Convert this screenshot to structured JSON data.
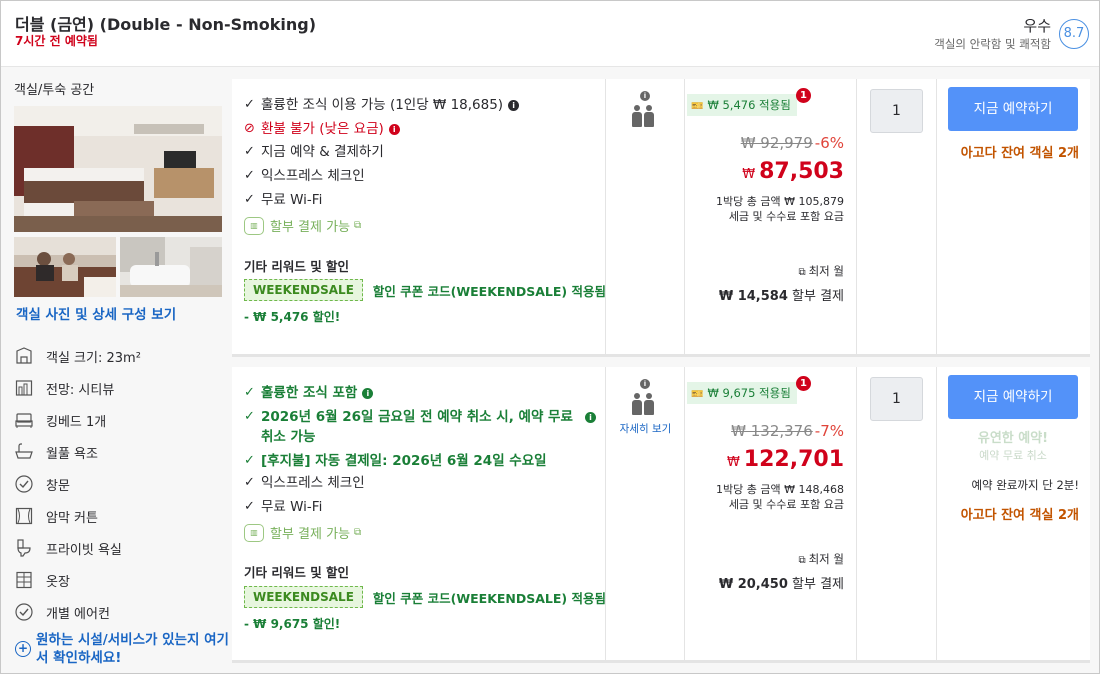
{
  "header": {
    "title": "더블 (금연) (Double - Non-Smoking)",
    "booked_ago": "7시간 전 예약됨",
    "rating_word": "우수",
    "rating_sub": "객실의 안락함 및 쾌적함",
    "score": "8.7"
  },
  "left": {
    "section_title": "객실/투숙 공간",
    "photos_link": "객실 사진 및 상세 구성 보기",
    "features": [
      {
        "label": "객실 크기: 23m²",
        "icon": "room-size-icon"
      },
      {
        "label": "전망: 시티뷰",
        "icon": "city-view-icon"
      },
      {
        "label": "킹베드 1개",
        "icon": "bed-icon"
      },
      {
        "label": "월풀 욕조",
        "icon": "bathtub-icon"
      },
      {
        "label": "창문",
        "icon": "check-circle-icon"
      },
      {
        "label": "암막 커튼",
        "icon": "curtain-icon"
      },
      {
        "label": "프라이빗 욕실",
        "icon": "toilet-icon"
      },
      {
        "label": "옷장",
        "icon": "wardrobe-icon"
      },
      {
        "label": "개별 에어컨",
        "icon": "check-circle-icon"
      }
    ],
    "more_link": "원하는 시설/서비스가 있는지 여기서 확인하세요!"
  },
  "offers": [
    {
      "benefits": [
        {
          "text": "훌륭한 조식 이용 가능 (1인당 ₩ 18,685)",
          "style": "plain",
          "mark": "✓",
          "info": "dark"
        },
        {
          "text": "환불 불가 (낮은 요금)",
          "style": "red",
          "mark": "⊘",
          "info": "red"
        },
        {
          "text": "지금 예약 & 결제하기",
          "style": "plain",
          "mark": "✓",
          "info": ""
        },
        {
          "text": "익스프레스 체크인",
          "style": "plain",
          "mark": "✓",
          "info": ""
        },
        {
          "text": "무료 Wi-Fi",
          "style": "plain",
          "mark": "✓",
          "info": ""
        }
      ],
      "installment": "할부 결제 가능",
      "reward_title": "기타 리워드 및 할인",
      "coupon_code": "WEEKENDSALE",
      "coupon_text": "할인 쿠폰 코드(WEEKENDSALE) 적용됨",
      "discount_text": "- ₩ 5,476 할인!",
      "occupancy_link": "",
      "applied": "₩ 5,476 적용됨",
      "badge": "1",
      "original_price": "₩ 92,979",
      "discount_pct": "-6%",
      "currency": "₩",
      "final_price": "87,503",
      "per_night_line1": "1박당 총 금액 ₩ 105,879",
      "per_night_line2": "세금 및 수수료 포함 요금",
      "monthly_label": "최저 월",
      "monthly_amount": "₩ 14,584",
      "monthly_suffix": "할부 결제",
      "quantity": "1",
      "book_button": "지금 예약하기",
      "rooms_left": "아고다 잔여 객실 2개",
      "flex_title": "",
      "flex_sub": "",
      "only_text": ""
    },
    {
      "benefits": [
        {
          "text": "훌륭한 조식 포함",
          "style": "green",
          "mark": "✓",
          "info": "green"
        },
        {
          "text": "2026년 6월 26일 금요일 전 예약 취소 시, 예약 무료 취소 가능",
          "style": "green",
          "mark": "✓",
          "info": "green"
        },
        {
          "text": "[후지불] 자동 결제일: 2026년 6월 24일 수요일",
          "style": "green",
          "mark": "✓",
          "info": ""
        },
        {
          "text": "익스프레스 체크인",
          "style": "plain",
          "mark": "✓",
          "info": ""
        },
        {
          "text": "무료 Wi-Fi",
          "style": "plain",
          "mark": "✓",
          "info": ""
        }
      ],
      "installment": "할부 결제 가능",
      "reward_title": "기타 리워드 및 할인",
      "coupon_code": "WEEKENDSALE",
      "coupon_text": "할인 쿠폰 코드(WEEKENDSALE) 적용됨",
      "discount_text": "- ₩ 9,675 할인!",
      "occupancy_link": "자세히 보기",
      "applied": "₩ 9,675 적용됨",
      "badge": "1",
      "original_price": "₩ 132,376",
      "discount_pct": "-7%",
      "currency": "₩",
      "final_price": "122,701",
      "per_night_line1": "1박당 총 금액 ₩ 148,468",
      "per_night_line2": "세금 및 수수료 포함 요금",
      "monthly_label": "최저 월",
      "monthly_amount": "₩ 20,450",
      "monthly_suffix": "할부 결제",
      "quantity": "1",
      "book_button": "지금 예약하기",
      "rooms_left": "아고다 잔여 객실 2개",
      "flex_title": "유연한 예약!",
      "flex_sub": "예약 무료 취소",
      "only_text": "예약 완료까지 단 2분!"
    }
  ]
}
